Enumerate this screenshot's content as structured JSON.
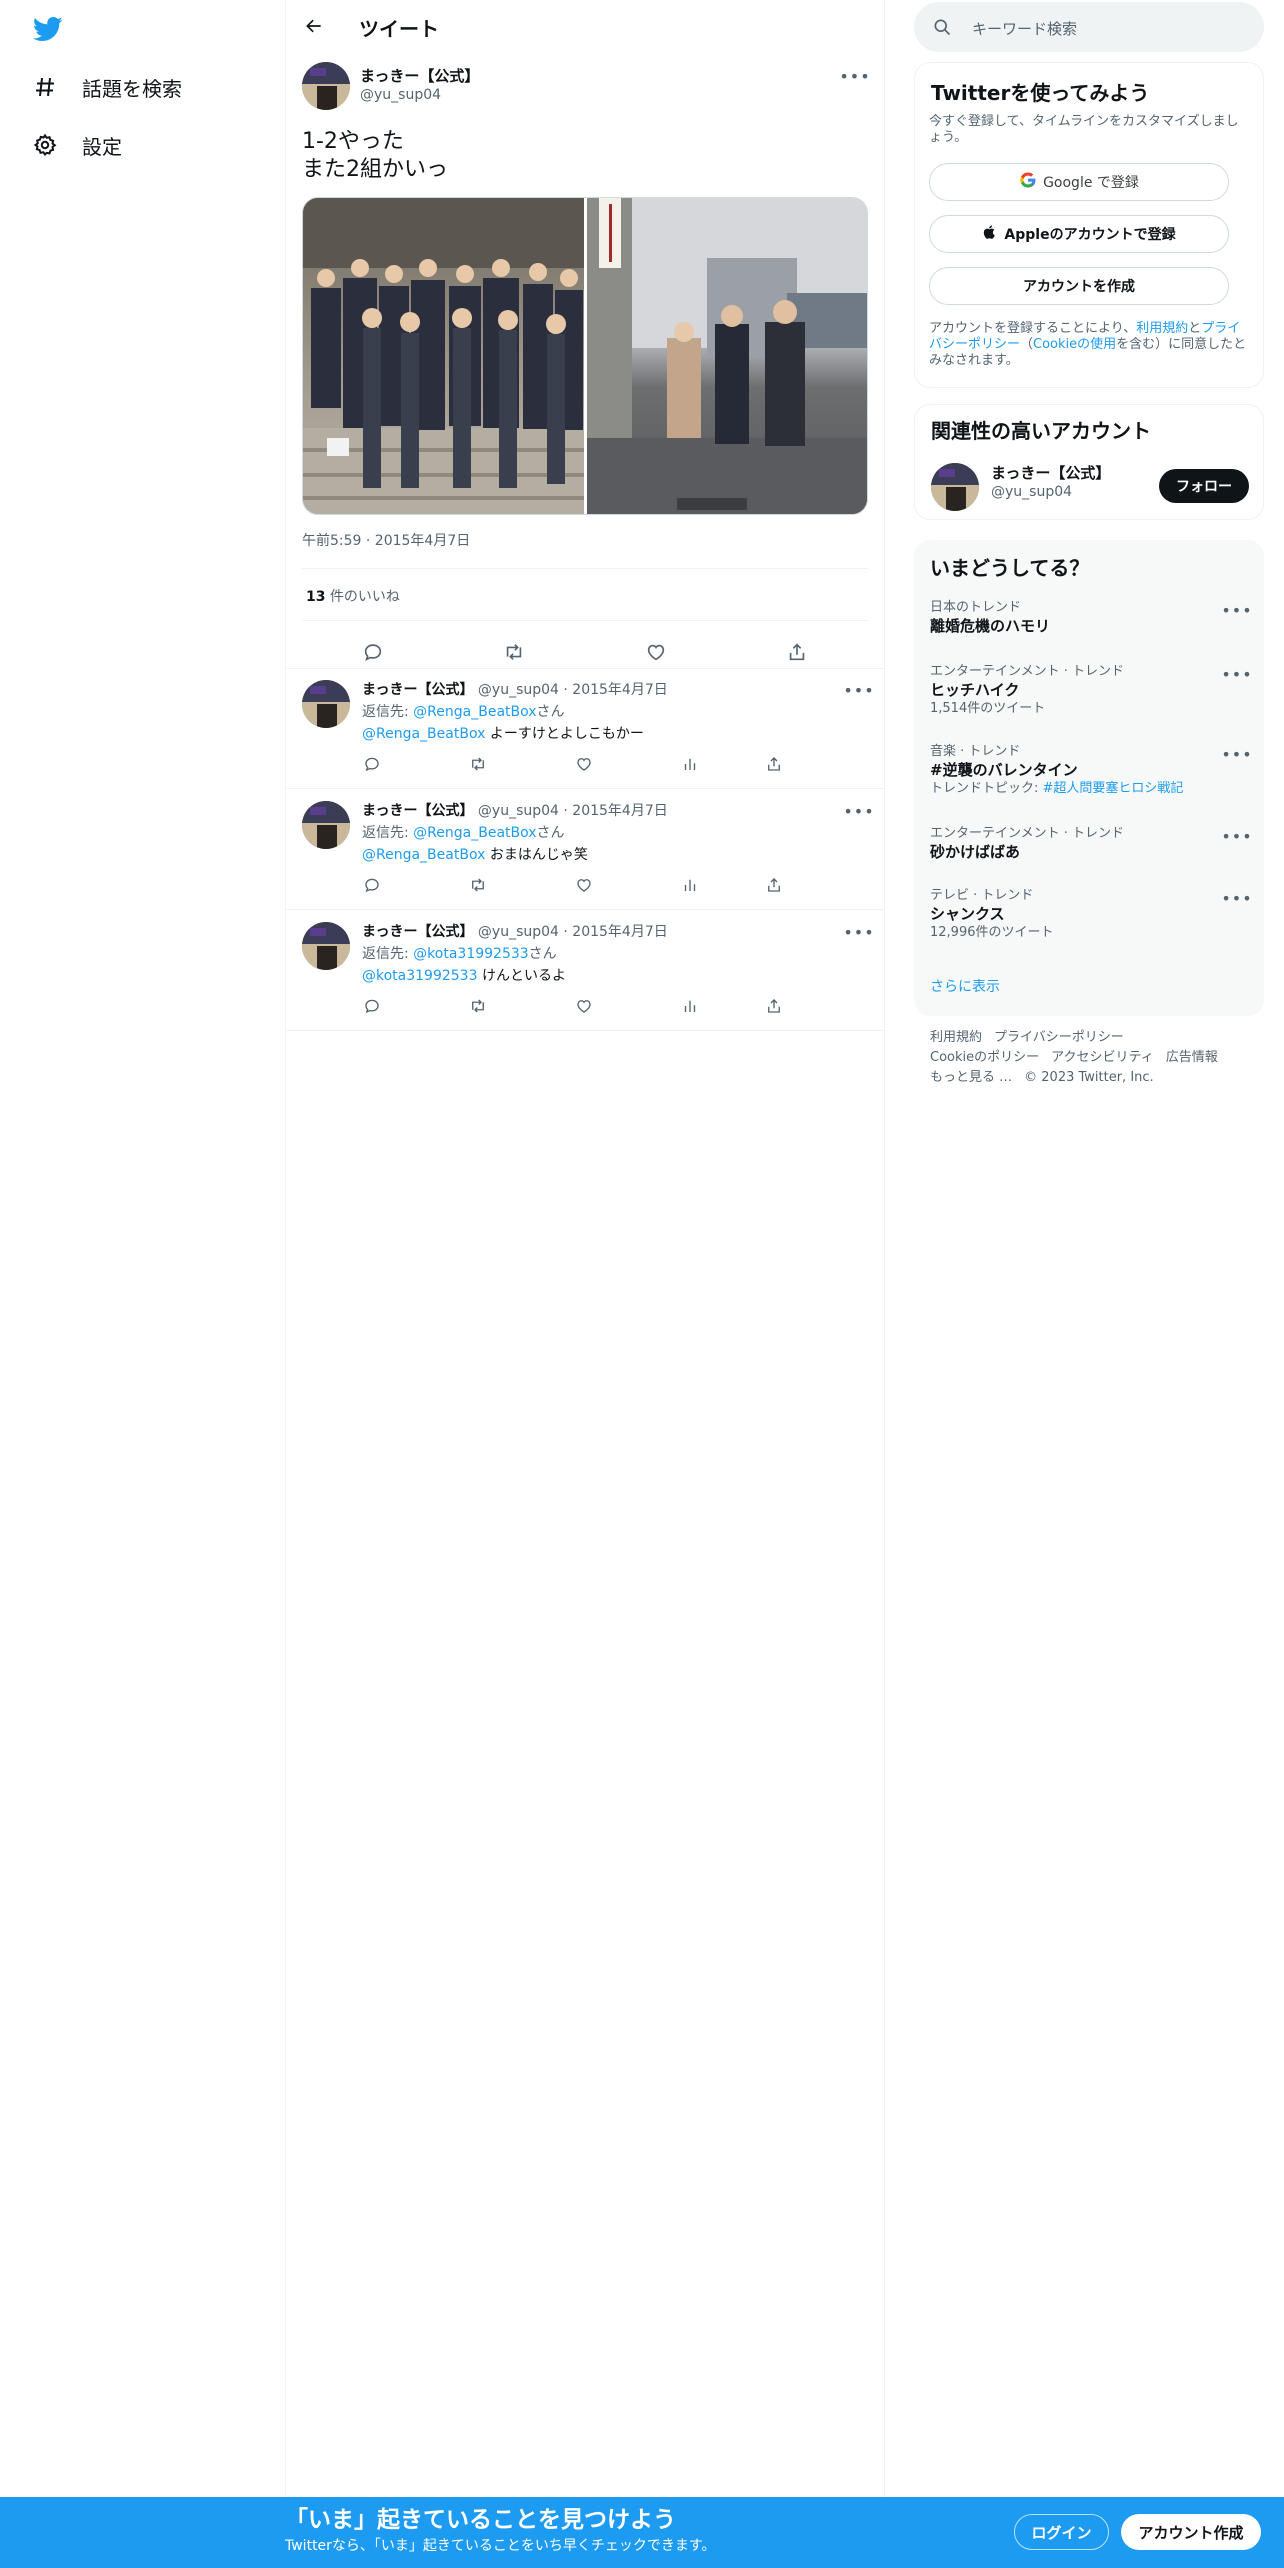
{
  "nav": {
    "items": [
      {
        "label": "話題を検索",
        "icon": "hashtag-icon"
      },
      {
        "label": "設定",
        "icon": "gear-icon"
      }
    ]
  },
  "header": {
    "title": "ツイート"
  },
  "main_tweet": {
    "name": "まっきー【公式】",
    "handle": "@yu_sup04",
    "text": "1-2やった\nまた2組かいっ",
    "timestamp": "午前5:59 · 2015年4月7日",
    "likes_count": "13",
    "likes_label": " 件のいいね"
  },
  "replies": [
    {
      "name": "まっきー【公式】",
      "handle": "@yu_sup04",
      "date": " · 2015年4月7日",
      "reply_prefix": "返信先: ",
      "reply_to": "@Renga_BeatBox",
      "reply_suffix": "さん",
      "mention": "@Renga_BeatBox",
      "text": " よーすけとよしこもかー"
    },
    {
      "name": "まっきー【公式】",
      "handle": "@yu_sup04",
      "date": " · 2015年4月7日",
      "reply_prefix": "返信先: ",
      "reply_to": "@Renga_BeatBox",
      "reply_suffix": "さん",
      "mention": "@Renga_BeatBox",
      "text": " おまはんじゃ笑"
    },
    {
      "name": "まっきー【公式】",
      "handle": "@yu_sup04",
      "date": " · 2015年4月7日",
      "reply_prefix": "返信先: ",
      "reply_to": "@kota31992533",
      "reply_suffix": "さん",
      "mention": "@kota31992533",
      "text": " けんといるよ"
    }
  ],
  "search": {
    "placeholder": "キーワード検索"
  },
  "signup_card": {
    "title": "Twitterを使ってみよう",
    "subtitle": "今すぐ登録して、タイムラインをカスタマイズしましょう。",
    "google_button": "Google で登録",
    "apple_button": "Appleのアカウントで登録",
    "create_button": "アカウントを作成",
    "terms_prefix": "アカウントを登録することにより、",
    "terms_link": "利用規約",
    "terms_and": "と",
    "privacy_link": "プライバシーポリシー",
    "terms_open": "（",
    "cookie_link": "Cookieの使用",
    "terms_suffix": "を含む）に同意したとみなされます。"
  },
  "related_card": {
    "title": "関連性の高いアカウント",
    "name": "まっきー【公式】",
    "handle": "@yu_sup04",
    "follow_button": "フォロー"
  },
  "trends_card": {
    "title": "いまどうしてる？",
    "trends": [
      {
        "category": "日本のトレンド",
        "name": "離婚危機のハモリ",
        "count": ""
      },
      {
        "category": "エンターテインメント · トレンド",
        "name": "ヒッチハイク",
        "count": "1,514件のツイート"
      },
      {
        "category": "音楽 · トレンド",
        "name": "#逆襲のバレンタイン",
        "count_prefix": "トレンドトピック: ",
        "count_link": "#超人問要塞ヒロシ戦記"
      },
      {
        "category": "エンターテインメント · トレンド",
        "name": "砂かけばばあ",
        "count": ""
      },
      {
        "category": "テレビ · トレンド",
        "name": "シャンクス",
        "count": "12,996件のツイート"
      }
    ],
    "show_more": "さらに表示"
  },
  "footer": {
    "line1": [
      "利用規約",
      "プライバシーポリシー"
    ],
    "line2": [
      "Cookieのポリシー",
      "アクセシビリティ",
      "広告情報"
    ],
    "more": "もっと見る …",
    "copyright": "© 2023 Twitter, Inc."
  },
  "bottom_bar": {
    "title": "「いま」起きていることを見つけよう",
    "subtitle": "Twitterなら、「いま」起きていることをいち早くチェックできます。",
    "login": "ログイン",
    "signup": "アカウント作成"
  },
  "colors": {
    "brand": "#1d9bf0",
    "text": "#0f1419",
    "secondary": "#536471",
    "border": "#eff3f4"
  }
}
